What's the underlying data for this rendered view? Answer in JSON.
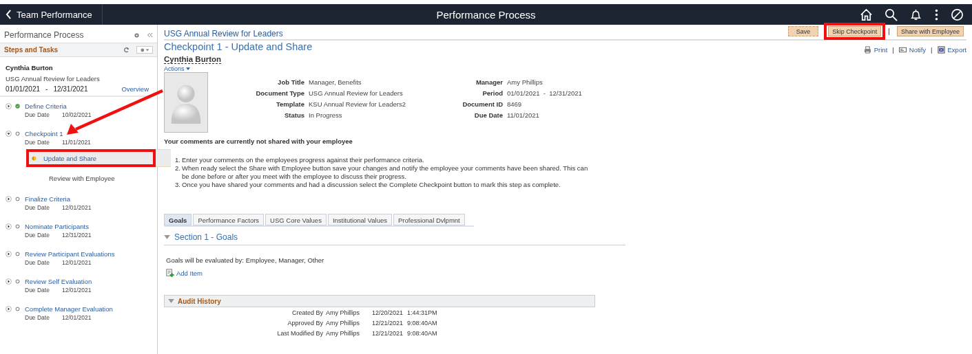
{
  "header": {
    "back_label": "Team Performance",
    "title": "Performance Process"
  },
  "sidebar": {
    "title": "Performance Process",
    "section": "Steps and Tasks",
    "employee": "Cynthia Burton",
    "document": "USG Annual Review for Leaders",
    "period_start": "01/01/2021",
    "period_separator": "-",
    "period_end": "12/31/2021",
    "overview_link": "Overview",
    "steps": [
      {
        "name": "Define Criteria",
        "kind": "done",
        "expanded": false,
        "due_label": "Due Date",
        "due": "10/02/2021"
      },
      {
        "name": "Checkpoint 1",
        "kind": "pending",
        "expanded": true,
        "due_label": "Due Date",
        "due": "11/01/2021",
        "children": [
          {
            "name": "Update and Share",
            "kind": "in-progress",
            "selected": true
          },
          {
            "name": "Review with Employee",
            "kind": "none",
            "selected": false
          }
        ]
      },
      {
        "name": "Finalize Criteria",
        "kind": "pending",
        "expanded": false,
        "due_label": "Due Date",
        "due": "12/01/2021"
      },
      {
        "name": "Nominate Participants",
        "kind": "pending",
        "expanded": false,
        "due_label": "Due Date",
        "due": "12/31/2021"
      },
      {
        "name": "Review Participant Evaluations",
        "kind": "pending",
        "expanded": false,
        "due_label": "Due Date",
        "due": "12/01/2021"
      },
      {
        "name": "Review Self Evaluation",
        "kind": "pending",
        "expanded": false,
        "due_label": "Due Date",
        "due": "12/01/2021"
      },
      {
        "name": "Complete Manager Evaluation",
        "kind": "pending",
        "expanded": false,
        "due_label": "Due Date",
        "due": "12/01/2021"
      }
    ]
  },
  "main": {
    "doc_title": "USG Annual Review for Leaders",
    "page_title": "Checkpoint 1 - Update and Share",
    "buttons": [
      "Save",
      "Skip Checkpoint",
      "Share with Employee"
    ],
    "button_separator": "|",
    "links": [
      {
        "label": "Print",
        "kind": "print"
      },
      {
        "label": "Notify",
        "kind": "notify"
      },
      {
        "label": "Export",
        "kind": "export"
      }
    ],
    "link_separator": "|",
    "employee": "Cynthia Burton",
    "actions": "Actions",
    "details_left": [
      {
        "label": "Job Title",
        "value": "Manager, Benefits"
      },
      {
        "label": "Document Type",
        "value": "USG Annual Review for Leaders"
      },
      {
        "label": "Template",
        "value": "KSU Annual Review for Leaders2"
      },
      {
        "label": "Status",
        "value": "In Progress"
      }
    ],
    "details_right": [
      {
        "label": "Manager",
        "value": "Amy Phillips"
      },
      {
        "label": "Period",
        "value": "01/01/2021  -  12/31/2021"
      },
      {
        "label": "Document ID",
        "value": "8469"
      },
      {
        "label": "Due Date",
        "value": "11/01/2021"
      }
    ],
    "notice": "Your comments are currently not shared with your employee",
    "instructions": [
      {
        "number": "1.",
        "text": "Enter your comments on the employees progress against their performance criteria."
      },
      {
        "number": "2.",
        "text": "When ready select the Share with Employee button save your changes and notify the employee your comments have been shared. This can be done before or after you meet with the employee to discuss their progress."
      },
      {
        "number": "3.",
        "text": "Once you have shared your comments and had a discussion select the Complete Checkpoint button to mark this step as complete."
      }
    ],
    "tabs": [
      {
        "label": "Goals",
        "selected": true
      },
      {
        "label": "Performance Factors",
        "selected": false
      },
      {
        "label": "USG Core Values",
        "selected": false
      },
      {
        "label": "Institutional Values",
        "selected": false
      },
      {
        "label": "Professional Dvlpmnt",
        "selected": false
      }
    ],
    "section_title": "Section 1 - Goals",
    "evaluated_by": "Goals will be evaluated by: Employee, Manager, Other",
    "add_item": "Add Item",
    "audit": {
      "title": "Audit History",
      "rows": [
        {
          "label": "Created By",
          "name": "Amy Phillips",
          "date": "12/20/2021",
          "time": "1:44:31PM"
        },
        {
          "label": "Approved By",
          "name": "Amy Phillips",
          "date": "12/21/2021",
          "time": "9:08:40AM"
        },
        {
          "label": "Last Modified By",
          "name": "Amy Phillips",
          "date": "12/21/2021",
          "time": "9:08:40AM"
        }
      ]
    }
  },
  "annotations": {
    "skip_button_highlight": true,
    "substep_highlight": true,
    "arrow": true
  }
}
